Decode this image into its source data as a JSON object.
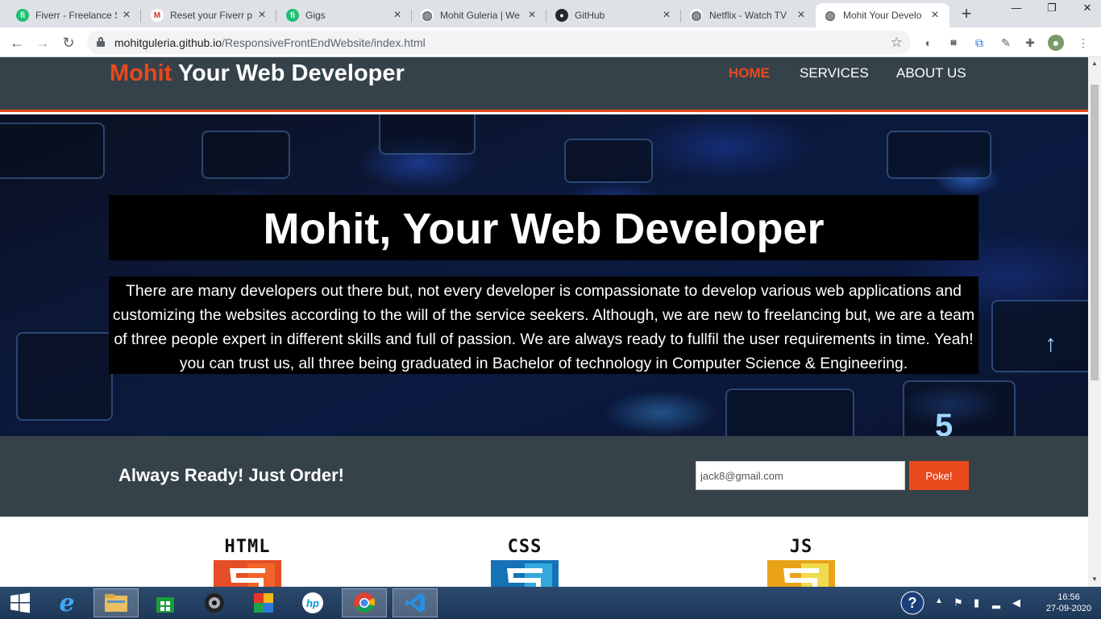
{
  "browser": {
    "tabs": [
      {
        "title": "Fiverr - Freelance S",
        "favicon": "fiverr-icon",
        "color": "#1dbf73",
        "glyph": "fi"
      },
      {
        "title": "Reset your Fiverr pa",
        "favicon": "gmail-icon",
        "color": "#d93025",
        "glyph": "M"
      },
      {
        "title": "Gigs",
        "favicon": "fiverr-icon",
        "color": "#1dbf73",
        "glyph": "fi"
      },
      {
        "title": "Mohit Guleria | We",
        "favicon": "globe-icon",
        "color": "#5f6368",
        "glyph": "◍"
      },
      {
        "title": "GitHub",
        "favicon": "github-icon",
        "color": "#24292e",
        "glyph": "●"
      },
      {
        "title": "Netflix - Watch TV",
        "favicon": "globe-icon",
        "color": "#5f6368",
        "glyph": "◍"
      },
      {
        "title": "Mohit Your Develo",
        "favicon": "globe-icon",
        "color": "#5f6368",
        "glyph": "◍"
      }
    ],
    "url_host": "mohitguleria.github.io",
    "url_path": "/ResponsiveFrontEndWebsite/index.html"
  },
  "site": {
    "brand_highlight": "Mohit",
    "brand_rest": " Your Web Developer",
    "nav": [
      "HOME",
      "SERVICES",
      "ABOUT US"
    ],
    "hero_title": "Mohit, Your Web Developer",
    "hero_text": "There are many developers out there but, not every developer is compassionate to develop various web applications and customizing the websites according to the will of the service seekers. Although, we are new to freelancing but, we are a team of three people expert in different skills and full of passion. We are always ready to fullfil the user requirements in time. Yeah! you can trust us, all three being graduated in Bachelor of technology in Computer Science & Engineering.",
    "newsletter_title": "Always Ready! Just Order!",
    "email_value": "jack8@gmail.com",
    "poke_label": "Poke!",
    "tech": [
      {
        "label": "HTML",
        "color": "#e44d26"
      },
      {
        "label": "CSS",
        "color": "#1572b6"
      },
      {
        "label": "JS",
        "color": "#f0a81c"
      }
    ],
    "accent_color": "#e8491d",
    "header_color": "#35424a"
  },
  "taskbar": {
    "time": "16:56",
    "date": "27-09-2020"
  }
}
